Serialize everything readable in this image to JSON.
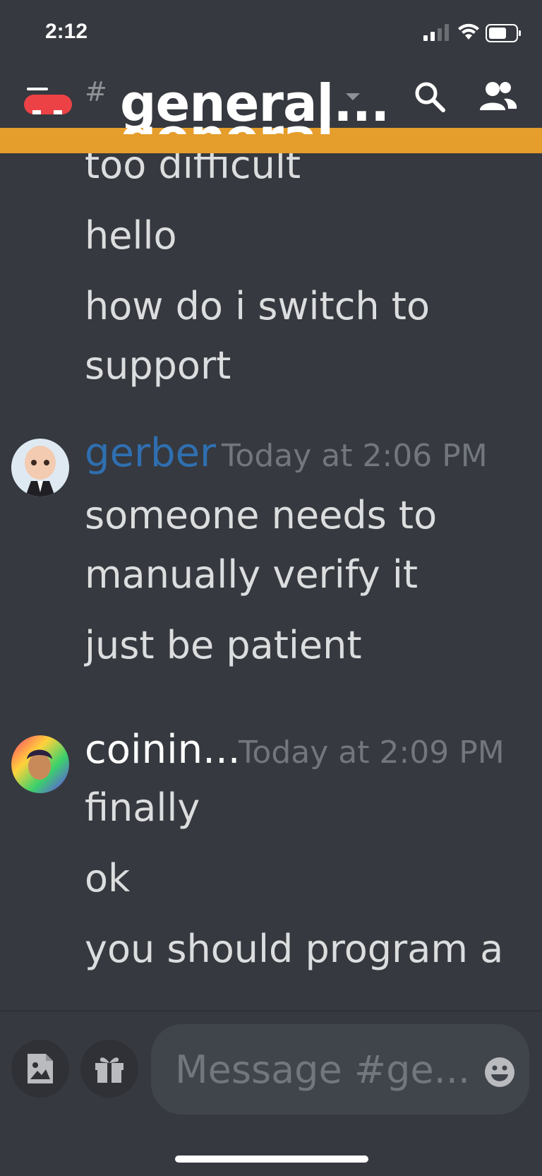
{
  "status_bar": {
    "time": "2:12"
  },
  "header": {
    "hash": "#",
    "channel_name": "general..."
  },
  "messages": {
    "continued": [
      "too difficult",
      "hello",
      "how do i switch to",
      "support"
    ],
    "groups": [
      {
        "author": "gerber",
        "author_color": "#2f6fb0",
        "timestamp": "Today at 2:06 PM",
        "lines": [
          "someone needs to",
          "manually verify it",
          "just be patient"
        ]
      },
      {
        "author": "coinin...",
        "author_color": "#ffffff",
        "timestamp": "Today at 2:09 PM",
        "lines": [
          "finally",
          "ok",
          "you should program a"
        ]
      }
    ]
  },
  "composer": {
    "placeholder": "Message #ge..."
  },
  "colors": {
    "banner": "#e59d2b",
    "background": "#36393f",
    "input": "#40444b"
  },
  "icons": [
    "hamburger-icon",
    "search-icon",
    "members-icon",
    "image-icon",
    "gift-icon",
    "emoji-icon",
    "chevron-down-icon"
  ]
}
